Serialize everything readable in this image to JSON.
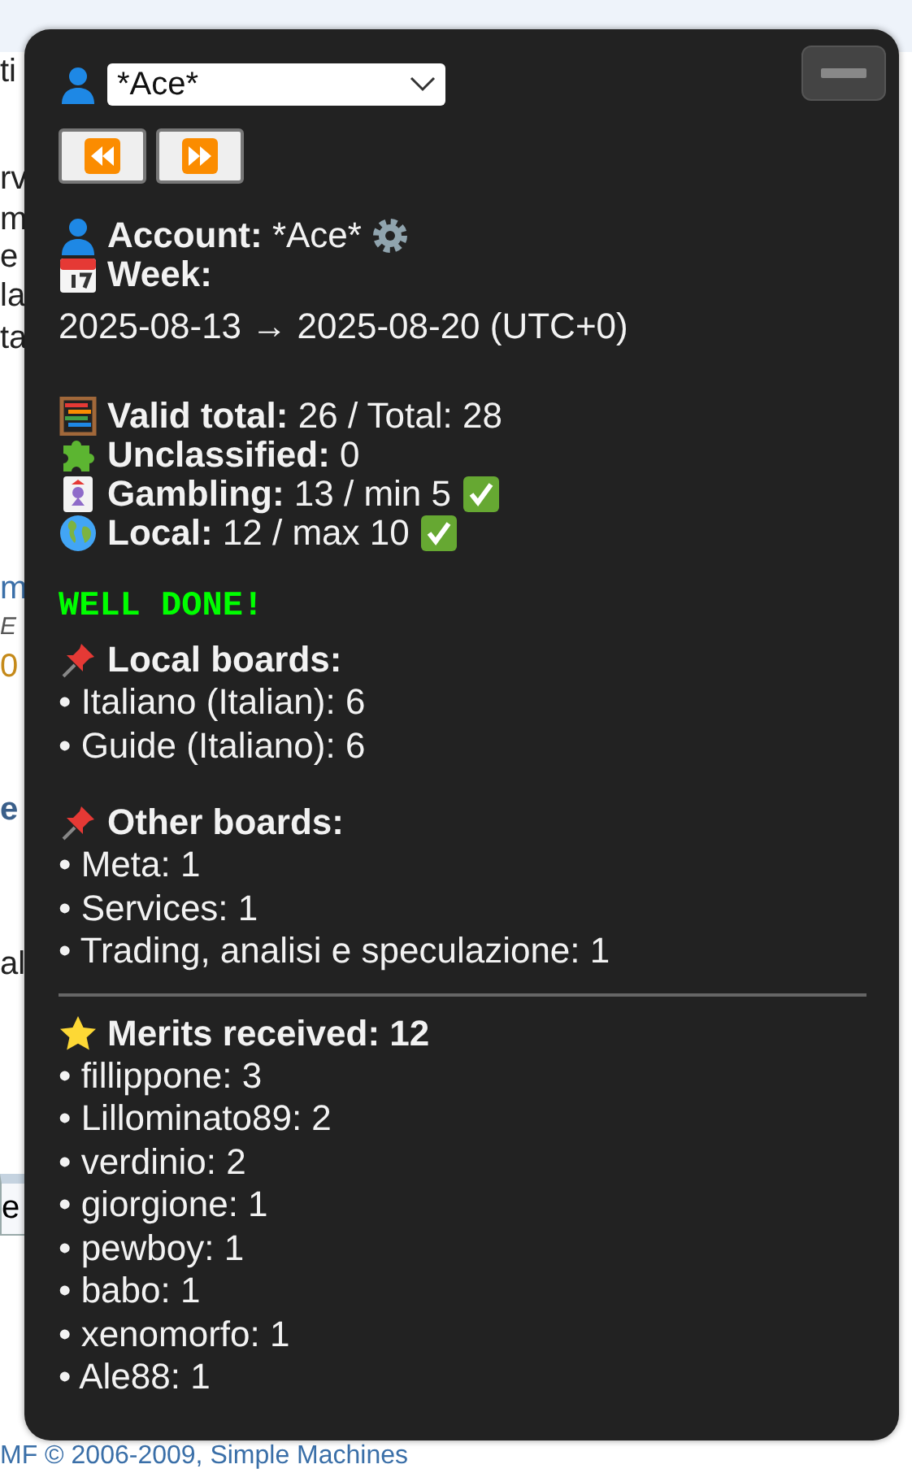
{
  "background": {
    "fragments": [
      {
        "text": "ti",
        "kind": "text"
      },
      {
        "text": "rv",
        "kind": "text"
      },
      {
        "text": "m",
        "kind": "text"
      },
      {
        "text": "e",
        "kind": "text"
      },
      {
        "text": "la",
        "kind": "text"
      },
      {
        "text": "ta",
        "kind": "text"
      },
      {
        "text": "m",
        "kind": "link"
      },
      {
        "text": "E",
        "kind": "meta"
      },
      {
        "text": "0",
        "kind": "count"
      },
      {
        "text": "e",
        "kind": "heading"
      },
      {
        "text": "al",
        "kind": "text"
      },
      {
        "text": "e",
        "kind": "field"
      }
    ],
    "footer": "MF © 2006-2009, Simple Machines"
  },
  "panel": {
    "account_select": {
      "value": "*Ace*"
    },
    "account": {
      "label": "Account:",
      "value": "*Ace*"
    },
    "week": {
      "label": "Week:",
      "range": "2025-08-13 → 2025-08-20 (UTC+0)"
    },
    "stats": [
      {
        "kind": "abacus",
        "label": "Valid total:",
        "value": "26 / Total: 28",
        "ok": false
      },
      {
        "kind": "puzzle",
        "label": "Unclassified:",
        "value": "0",
        "ok": false
      },
      {
        "kind": "card",
        "label": "Gambling:",
        "value": "13 / min 5",
        "ok": true
      },
      {
        "kind": "globe",
        "label": "Local:",
        "value": "12 / max 10",
        "ok": true
      }
    ],
    "status": "WELL DONE!",
    "local_boards": {
      "title": "Local boards:",
      "items": [
        "• Italiano (Italian): 6",
        "• Guide (Italiano): 6"
      ]
    },
    "other_boards": {
      "title": "Other boards:",
      "items": [
        "• Meta: 1",
        "• Services: 1",
        "• Trading, analisi e speculazione: 1"
      ]
    },
    "merits": {
      "title": "Merits received: 12",
      "items": [
        "• fillippone: 3",
        "• Lillominato89: 2",
        "• verdinio: 2",
        "• giorgione: 1",
        "• pewboy: 1",
        "• babo: 1",
        "• xenomorfo: 1",
        "• Ale88: 1"
      ]
    }
  }
}
